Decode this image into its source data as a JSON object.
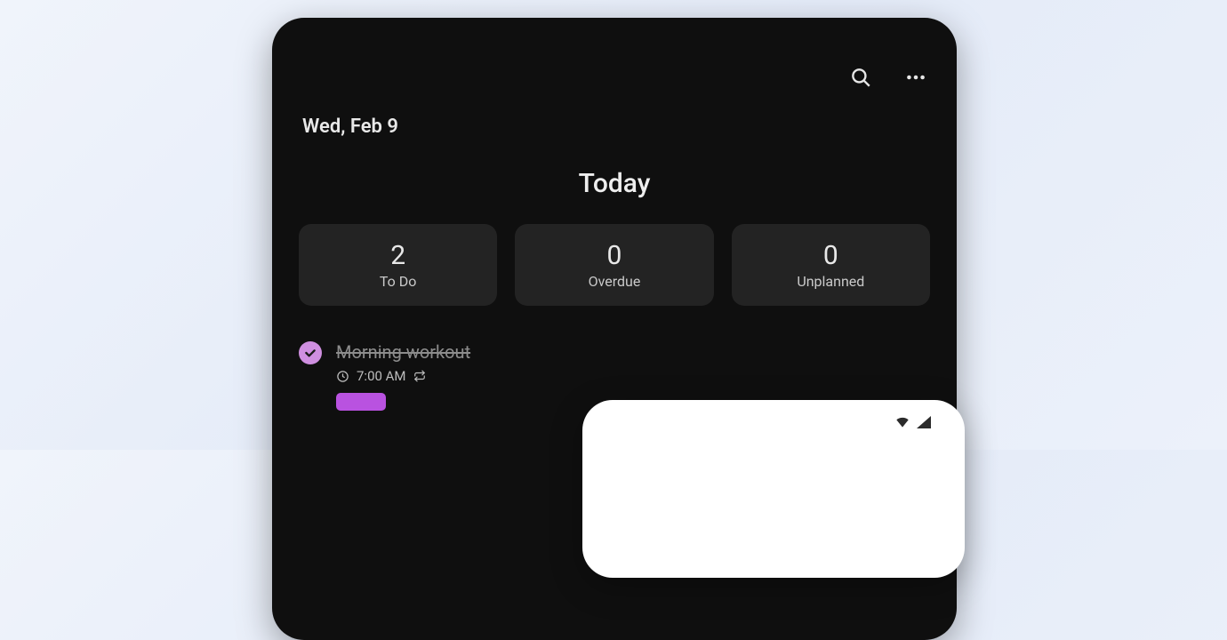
{
  "header": {
    "date": "Wed, Feb 9",
    "title": "Today"
  },
  "stats": [
    {
      "count": "2",
      "label": "To Do"
    },
    {
      "count": "0",
      "label": "Overdue"
    },
    {
      "count": "0",
      "label": "Unplanned"
    }
  ],
  "task": {
    "title": "Morning workout",
    "time": "7:00 AM"
  },
  "colors": {
    "accent": "#cf8fe0"
  }
}
